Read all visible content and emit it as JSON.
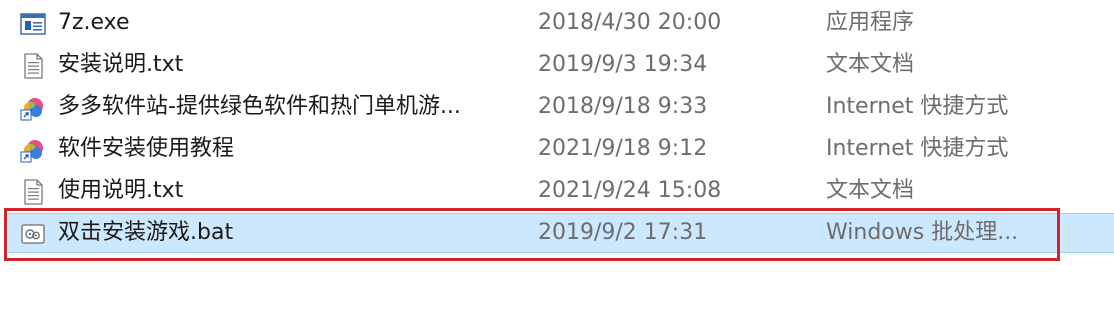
{
  "files": [
    {
      "name": "7z.exe",
      "date": "2018/4/30 20:00",
      "type": "应用程序",
      "icon": "exe-app-icon",
      "selected": false
    },
    {
      "name": "安装说明.txt",
      "date": "2019/9/3 19:34",
      "type": "文本文档",
      "icon": "text-document-icon",
      "selected": false
    },
    {
      "name": "多多软件站-提供绿色软件和热门单机游...",
      "date": "2018/9/18 9:33",
      "type": "Internet 快捷方式",
      "icon": "internet-shortcut-icon",
      "selected": false
    },
    {
      "name": "软件安装使用教程",
      "date": "2021/9/18 9:12",
      "type": "Internet 快捷方式",
      "icon": "internet-shortcut-icon",
      "selected": false
    },
    {
      "name": "使用说明.txt",
      "date": "2021/9/24 15:08",
      "type": "文本文档",
      "icon": "text-document-icon",
      "selected": false
    },
    {
      "name": "双击安装游戏.bat",
      "date": "2019/9/2 17:31",
      "type": "Windows 批处理...",
      "icon": "batch-file-icon",
      "selected": true
    }
  ],
  "colors": {
    "selection_background": "#cce8ff",
    "selection_border": "#99d1ff",
    "annotation_box": "#d0262b"
  }
}
